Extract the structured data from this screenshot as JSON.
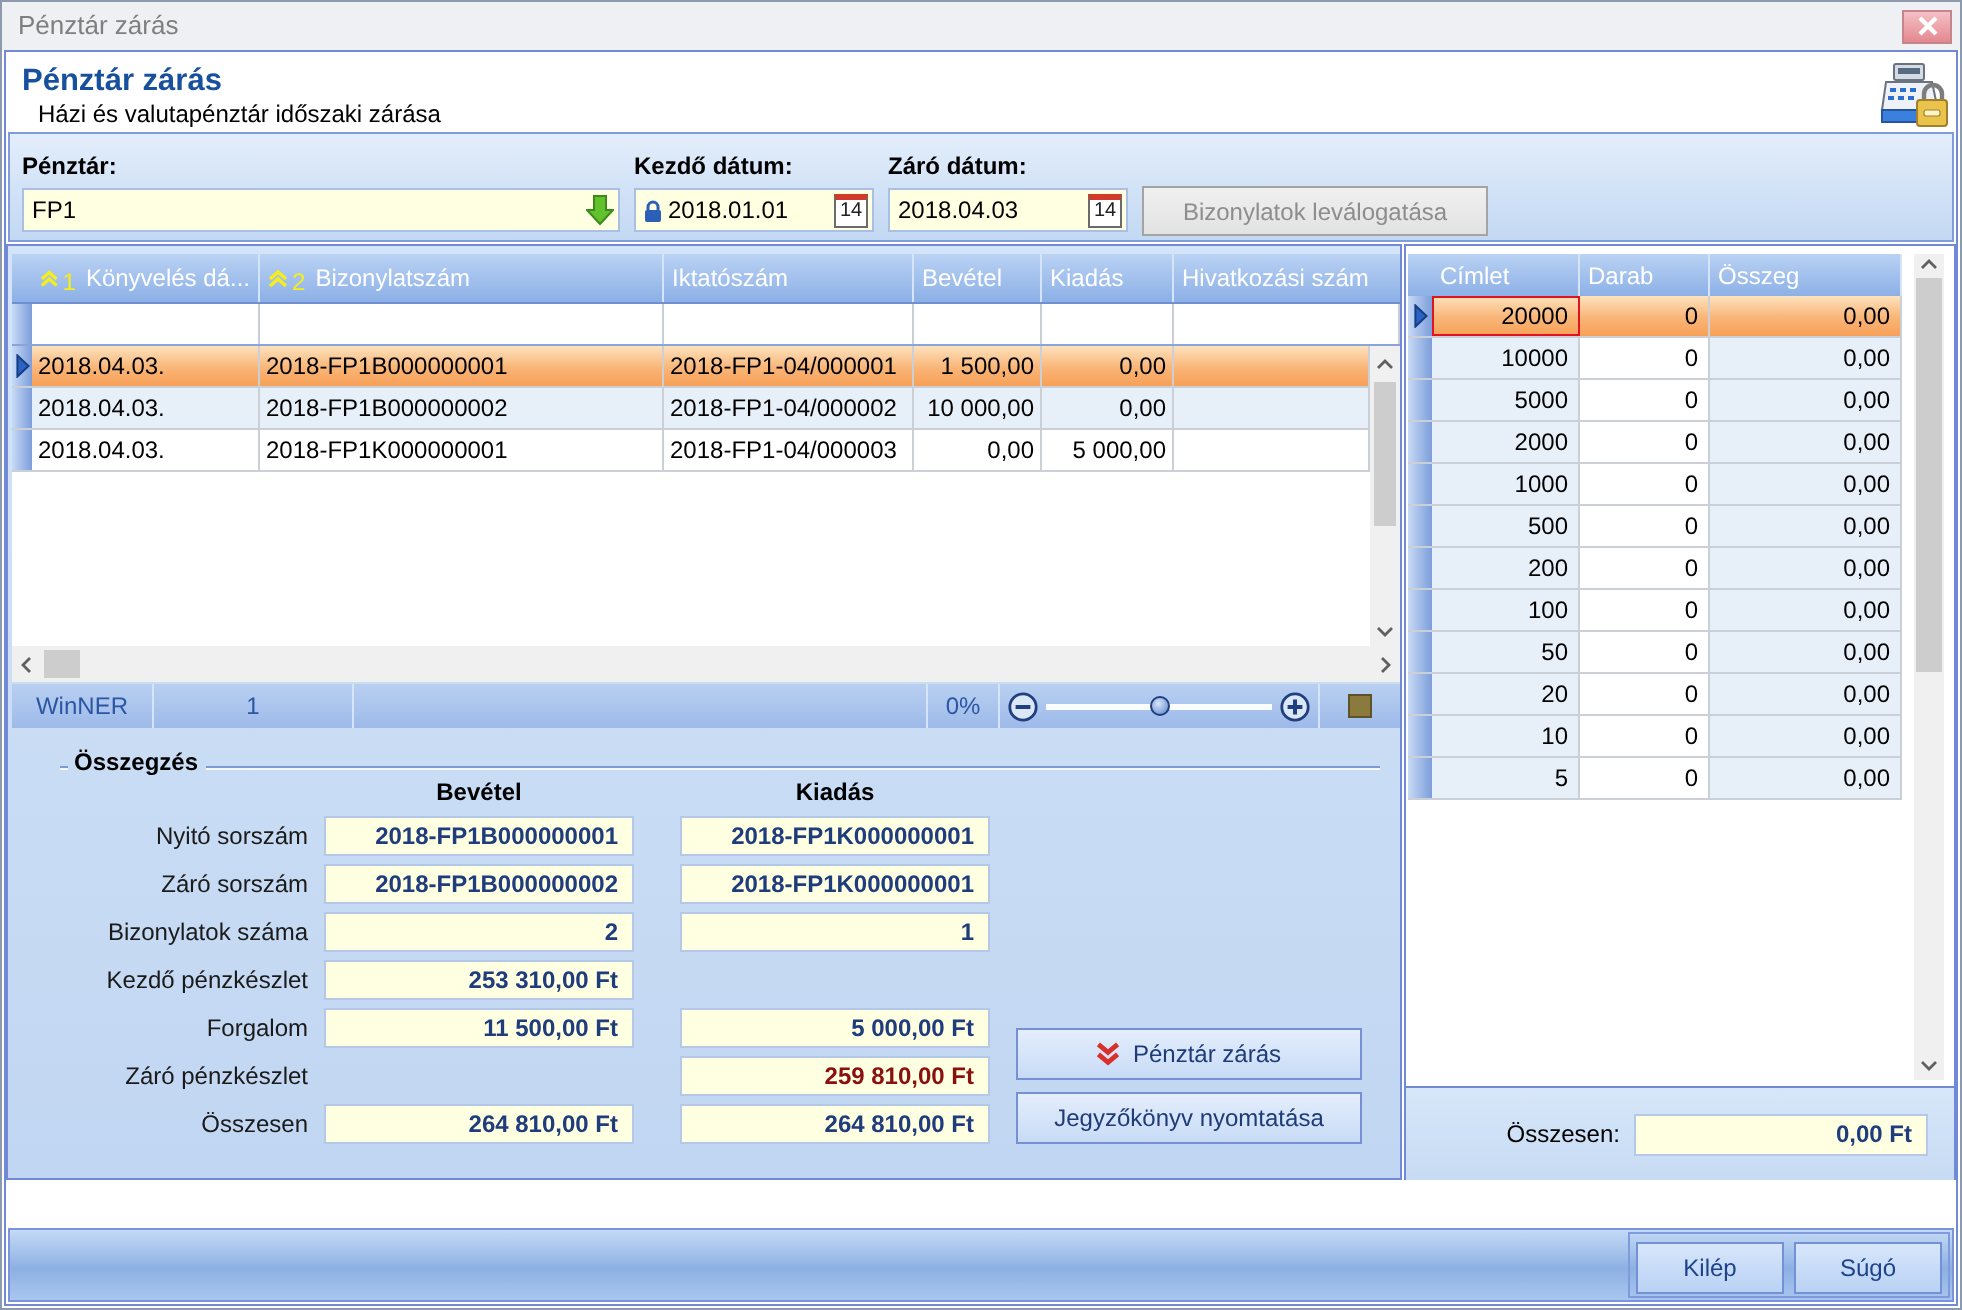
{
  "window": {
    "title": "Pénztár zárás"
  },
  "header": {
    "title": "Pénztár zárás",
    "subtitle": "Házi és valutapénztár időszaki zárása"
  },
  "filters": {
    "cash_desk": {
      "label": "Pénztár:",
      "value": "FP1"
    },
    "start_date": {
      "label": "Kezdő dátum:",
      "value": "2018.01.01",
      "locked": true,
      "calendar_day": "14"
    },
    "end_date": {
      "label": "Záró dátum:",
      "value": "2018.04.03",
      "locked": false,
      "calendar_day": "14"
    },
    "filter_button": {
      "label": "Bizonylatok leválogatása",
      "disabled": true
    }
  },
  "documents_table": {
    "columns": [
      {
        "label": "Könyvelés dá...",
        "kind": "text",
        "sort_order": "1"
      },
      {
        "label": "Bizonylatszám",
        "kind": "text",
        "sort_order": "2"
      },
      {
        "label": "Iktatószám",
        "kind": "text"
      },
      {
        "label": "Bevétel",
        "kind": "amount"
      },
      {
        "label": "Kiadás",
        "kind": "amount"
      },
      {
        "label": "Hivatkozási szám",
        "kind": "text"
      }
    ],
    "rows": [
      {
        "cells": [
          "2018.04.03.",
          "2018-FP1B000000001",
          "2018-FP1-04/000001",
          "1 500,00",
          "0,00"
        ],
        "selected": true
      },
      {
        "cells": [
          "2018.04.03.",
          "2018-FP1B000000002",
          "2018-FP1-04/000002",
          "10 000,00",
          "0,00"
        ],
        "selected": false
      },
      {
        "cells": [
          "2018.04.03.",
          "2018-FP1K000000001",
          "2018-FP1-04/000003",
          "0,00",
          "5 000,00"
        ],
        "selected": false
      }
    ]
  },
  "status_bar": {
    "app_name": "WinNER",
    "record_count": "1",
    "zoom": {
      "reading": "0%",
      "level": 0.5
    }
  },
  "summary": {
    "title": "Összegzés",
    "column_headers": [
      "Bevétel",
      "Kiadás"
    ],
    "rows": [
      {
        "label": "Nyitó sorszám",
        "income": "2018-FP1B000000001",
        "expense": "2018-FP1K000000001",
        "highlighted": false
      },
      {
        "label": "Záró sorszám",
        "income": "2018-FP1B000000002",
        "expense": "2018-FP1K000000001",
        "highlighted": false
      },
      {
        "label": "Bizonylatok száma",
        "income": "2",
        "expense": "1",
        "highlighted": false
      },
      {
        "label": "Kezdő pénzkészlet",
        "income": "253 310,00 Ft",
        "highlighted": false
      },
      {
        "label": "Forgalom",
        "income": "11 500,00 Ft",
        "expense": "5 000,00 Ft",
        "highlighted": false
      },
      {
        "label": "Záró pénzkészlet",
        "expense": "259 810,00 Ft",
        "highlighted": true
      },
      {
        "label": "Összesen",
        "income": "264 810,00 Ft",
        "expense": "264 810,00 Ft",
        "highlighted": false
      }
    ],
    "actions": [
      {
        "label": "Pénztár zárás",
        "kind": "close_register"
      },
      {
        "label": "Jegyzőkönyv nyomtatása",
        "kind": "print"
      }
    ]
  },
  "denominations": {
    "columns": [
      "Címlet",
      "Darab",
      "Összeg"
    ],
    "rows": [
      {
        "denomination": "20000",
        "count": "0",
        "amount": "0,00",
        "selected": true
      },
      {
        "denomination": "10000",
        "count": "0",
        "amount": "0,00",
        "selected": false
      },
      {
        "denomination": "5000",
        "count": "0",
        "amount": "0,00",
        "selected": false
      },
      {
        "denomination": "2000",
        "count": "0",
        "amount": "0,00",
        "selected": false
      },
      {
        "denomination": "1000",
        "count": "0",
        "amount": "0,00",
        "selected": false
      },
      {
        "denomination": "500",
        "count": "0",
        "amount": "0,00",
        "selected": false
      },
      {
        "denomination": "200",
        "count": "0",
        "amount": "0,00",
        "selected": false
      },
      {
        "denomination": "100",
        "count": "0",
        "amount": "0,00",
        "selected": false
      },
      {
        "denomination": "50",
        "count": "0",
        "amount": "0,00",
        "selected": false
      },
      {
        "denomination": "20",
        "count": "0",
        "amount": "0,00",
        "selected": false
      },
      {
        "denomination": "10",
        "count": "0",
        "amount": "0,00",
        "selected": false
      },
      {
        "denomination": "5",
        "count": "0",
        "amount": "0,00",
        "selected": false
      }
    ],
    "total": {
      "label": "Összesen:",
      "value": "0,00 Ft"
    }
  },
  "footer_buttons": [
    {
      "label": "Kilép"
    },
    {
      "label": "Súgó"
    }
  ]
}
